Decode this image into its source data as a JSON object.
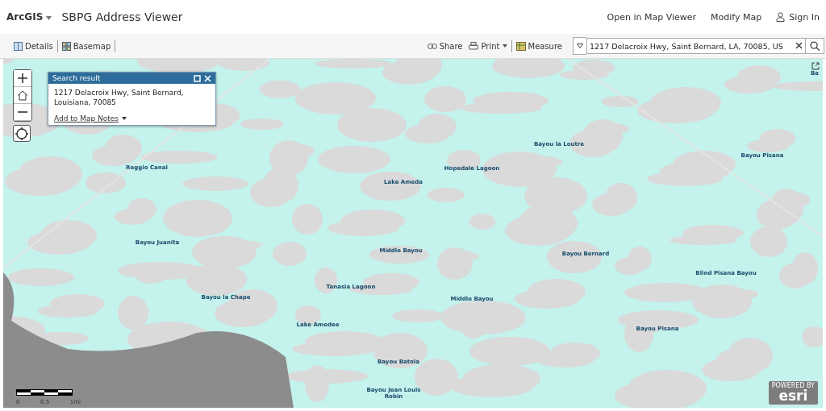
{
  "header": {
    "brand": "ArcGIS",
    "title": "SBPG Address Viewer",
    "links": [
      "Open in Map Viewer",
      "Modify Map"
    ],
    "sign_in": "Sign In"
  },
  "toolbar": {
    "left": [
      "Details",
      "Basemap"
    ],
    "share": "Share",
    "print": "Print",
    "measure": "Measure",
    "search": {
      "value": "1217 Delacroix Hwy, Saint Bernard, LA, 70085, US"
    }
  },
  "popup": {
    "title": "Search result",
    "address": "1217 Delacroix Hwy, Saint Bernard, Louisiana, 70085",
    "action": "Add to Map Notes"
  },
  "map": {
    "labels": [
      "Bayou la Loutre",
      "Bayou Pisana",
      "Reggio Canal",
      "Hopedale Lagoon",
      "Lake Ameda",
      "Bayou Juanita",
      "Middle Bayou",
      "Bayou Bernard",
      "Blind Pisana Bayou",
      "Tanasia Lagoon",
      "Bayou la Chape",
      "Middle Bayou",
      "Lake Amedee",
      "Bayou Pisana",
      "Bayou Batola",
      "Bayou Jean Louis Robin",
      "Ba"
    ],
    "scale": [
      "0",
      "0.5",
      "1mi"
    ],
    "attribution_small": "POWERED BY",
    "attribution": "esri"
  }
}
